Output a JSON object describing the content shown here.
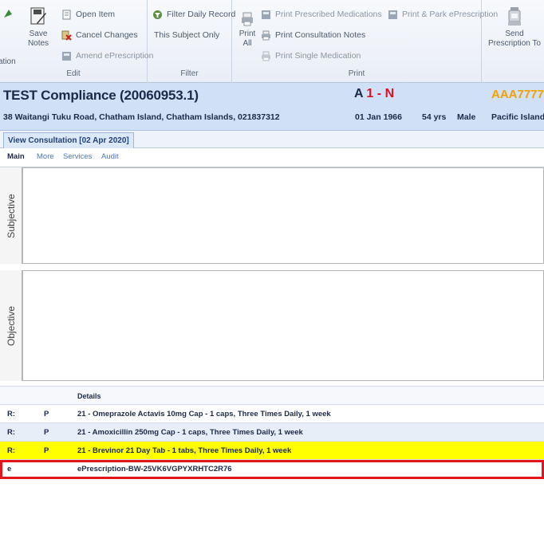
{
  "ribbon": {
    "partial_label": "ation",
    "edit": {
      "title": "Edit",
      "save_notes": "Save Notes",
      "open_item": "Open Item",
      "cancel_changes": "Cancel Changes",
      "amend_eprescription": "Amend ePrescription"
    },
    "filter": {
      "title": "Filter",
      "filter_daily_record": "Filter Daily Record",
      "this_subject_only": "This Subject Only"
    },
    "print": {
      "title": "Print",
      "print_all": "Print All",
      "print_prescribed_medications": "Print Prescribed Medications",
      "print_park_eprescription": "Print & Park ePrescription",
      "print_consultation_notes": "Print Consultation Notes",
      "print_single_medication": "Print Single Medication"
    },
    "send": {
      "send_prescription_to": "Send Prescription To"
    }
  },
  "patient": {
    "name": "TEST Compliance (20060953.1)",
    "flag_prefix": "A",
    "flag_number": "1",
    "flag_sep": "-",
    "flag_letter": "N",
    "nhi": "AAA7777",
    "address": "38 Waitangi Tuku Road, Chatham Island, Chatham Islands, 021837312",
    "dob": "01 Jan 1966",
    "age": "54 yrs",
    "sex": "Male",
    "ethnicity": "Pacific Island"
  },
  "consultation_tab": "View Consultation [02 Apr 2020]",
  "subtabs": [
    "Main",
    "More",
    "Services",
    "Audit"
  ],
  "panes": {
    "subjective": "Subjective",
    "objective": "Objective"
  },
  "grid": {
    "header": "Details",
    "rows": [
      {
        "c1": "R:",
        "c2": "P",
        "details": "21 - Omeprazole Actavis 10mg Cap - 1 caps, Three Times Daily, 1 week"
      },
      {
        "c1": "R:",
        "c2": "P",
        "details": "21 - Amoxicillin 250mg Cap - 1 caps, Three Times Daily, 1 week"
      },
      {
        "c1": "R:",
        "c2": "P",
        "details": "21 - Brevinor 21 Day Tab - 1 tabs, Three Times Daily, 1 week"
      },
      {
        "c1": "e",
        "c2": "",
        "details": "ePrescription-BW-25VK6VGPYXRHTC2R76"
      }
    ]
  },
  "colors": {
    "banner_bg": "#cfe0f7",
    "flag_red": "#e0101f",
    "nhi_orange": "#f2a000",
    "highlight_row": "#ffff00",
    "selected_border": "#e4141d"
  }
}
